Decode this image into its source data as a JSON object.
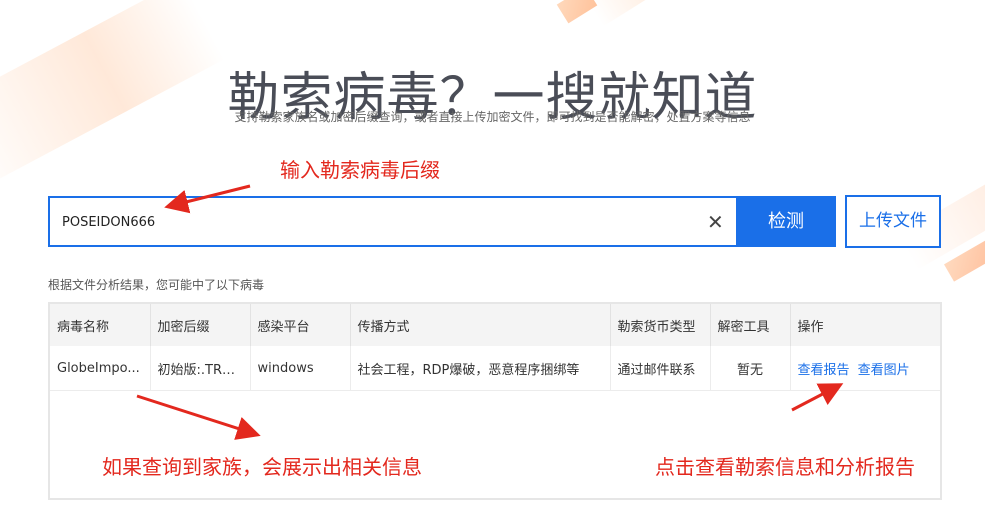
{
  "hero": {
    "title": "勒索病毒？一搜就知道",
    "subtitle": "支持勒索家族名或加密后缀查询，或者直接上传加密文件，即可找到是否能解密，处置方案等信息"
  },
  "annotations": {
    "input_hint": "输入勒索病毒后缀",
    "result_hint": "如果查询到家族，会展示出相关信息",
    "report_hint": "点击查看勒索信息和分析报告"
  },
  "search": {
    "value": "POSEIDON666",
    "placeholder": "",
    "detect_label": "检测",
    "upload_label": "上传文件"
  },
  "results": {
    "note": "根据文件分析结果，您可能中了以下病毒",
    "columns": [
      "病毒名称",
      "加密后缀",
      "感染平台",
      "传播方式",
      "勒索货币类型",
      "解密工具",
      "操作"
    ],
    "rows": [
      {
        "name": "GlobeImpo...",
        "suffix": "初始版:.TRU...",
        "platform": "windows",
        "spread": "社会工程，RDP爆破，恶意程序捆绑等",
        "currency": "通过邮件联系",
        "tool": "暂无",
        "action_report": "查看报告",
        "action_image": "查看图片"
      }
    ]
  },
  "colors": {
    "accent": "#1a6fe8",
    "annotation": "#e3281e"
  }
}
